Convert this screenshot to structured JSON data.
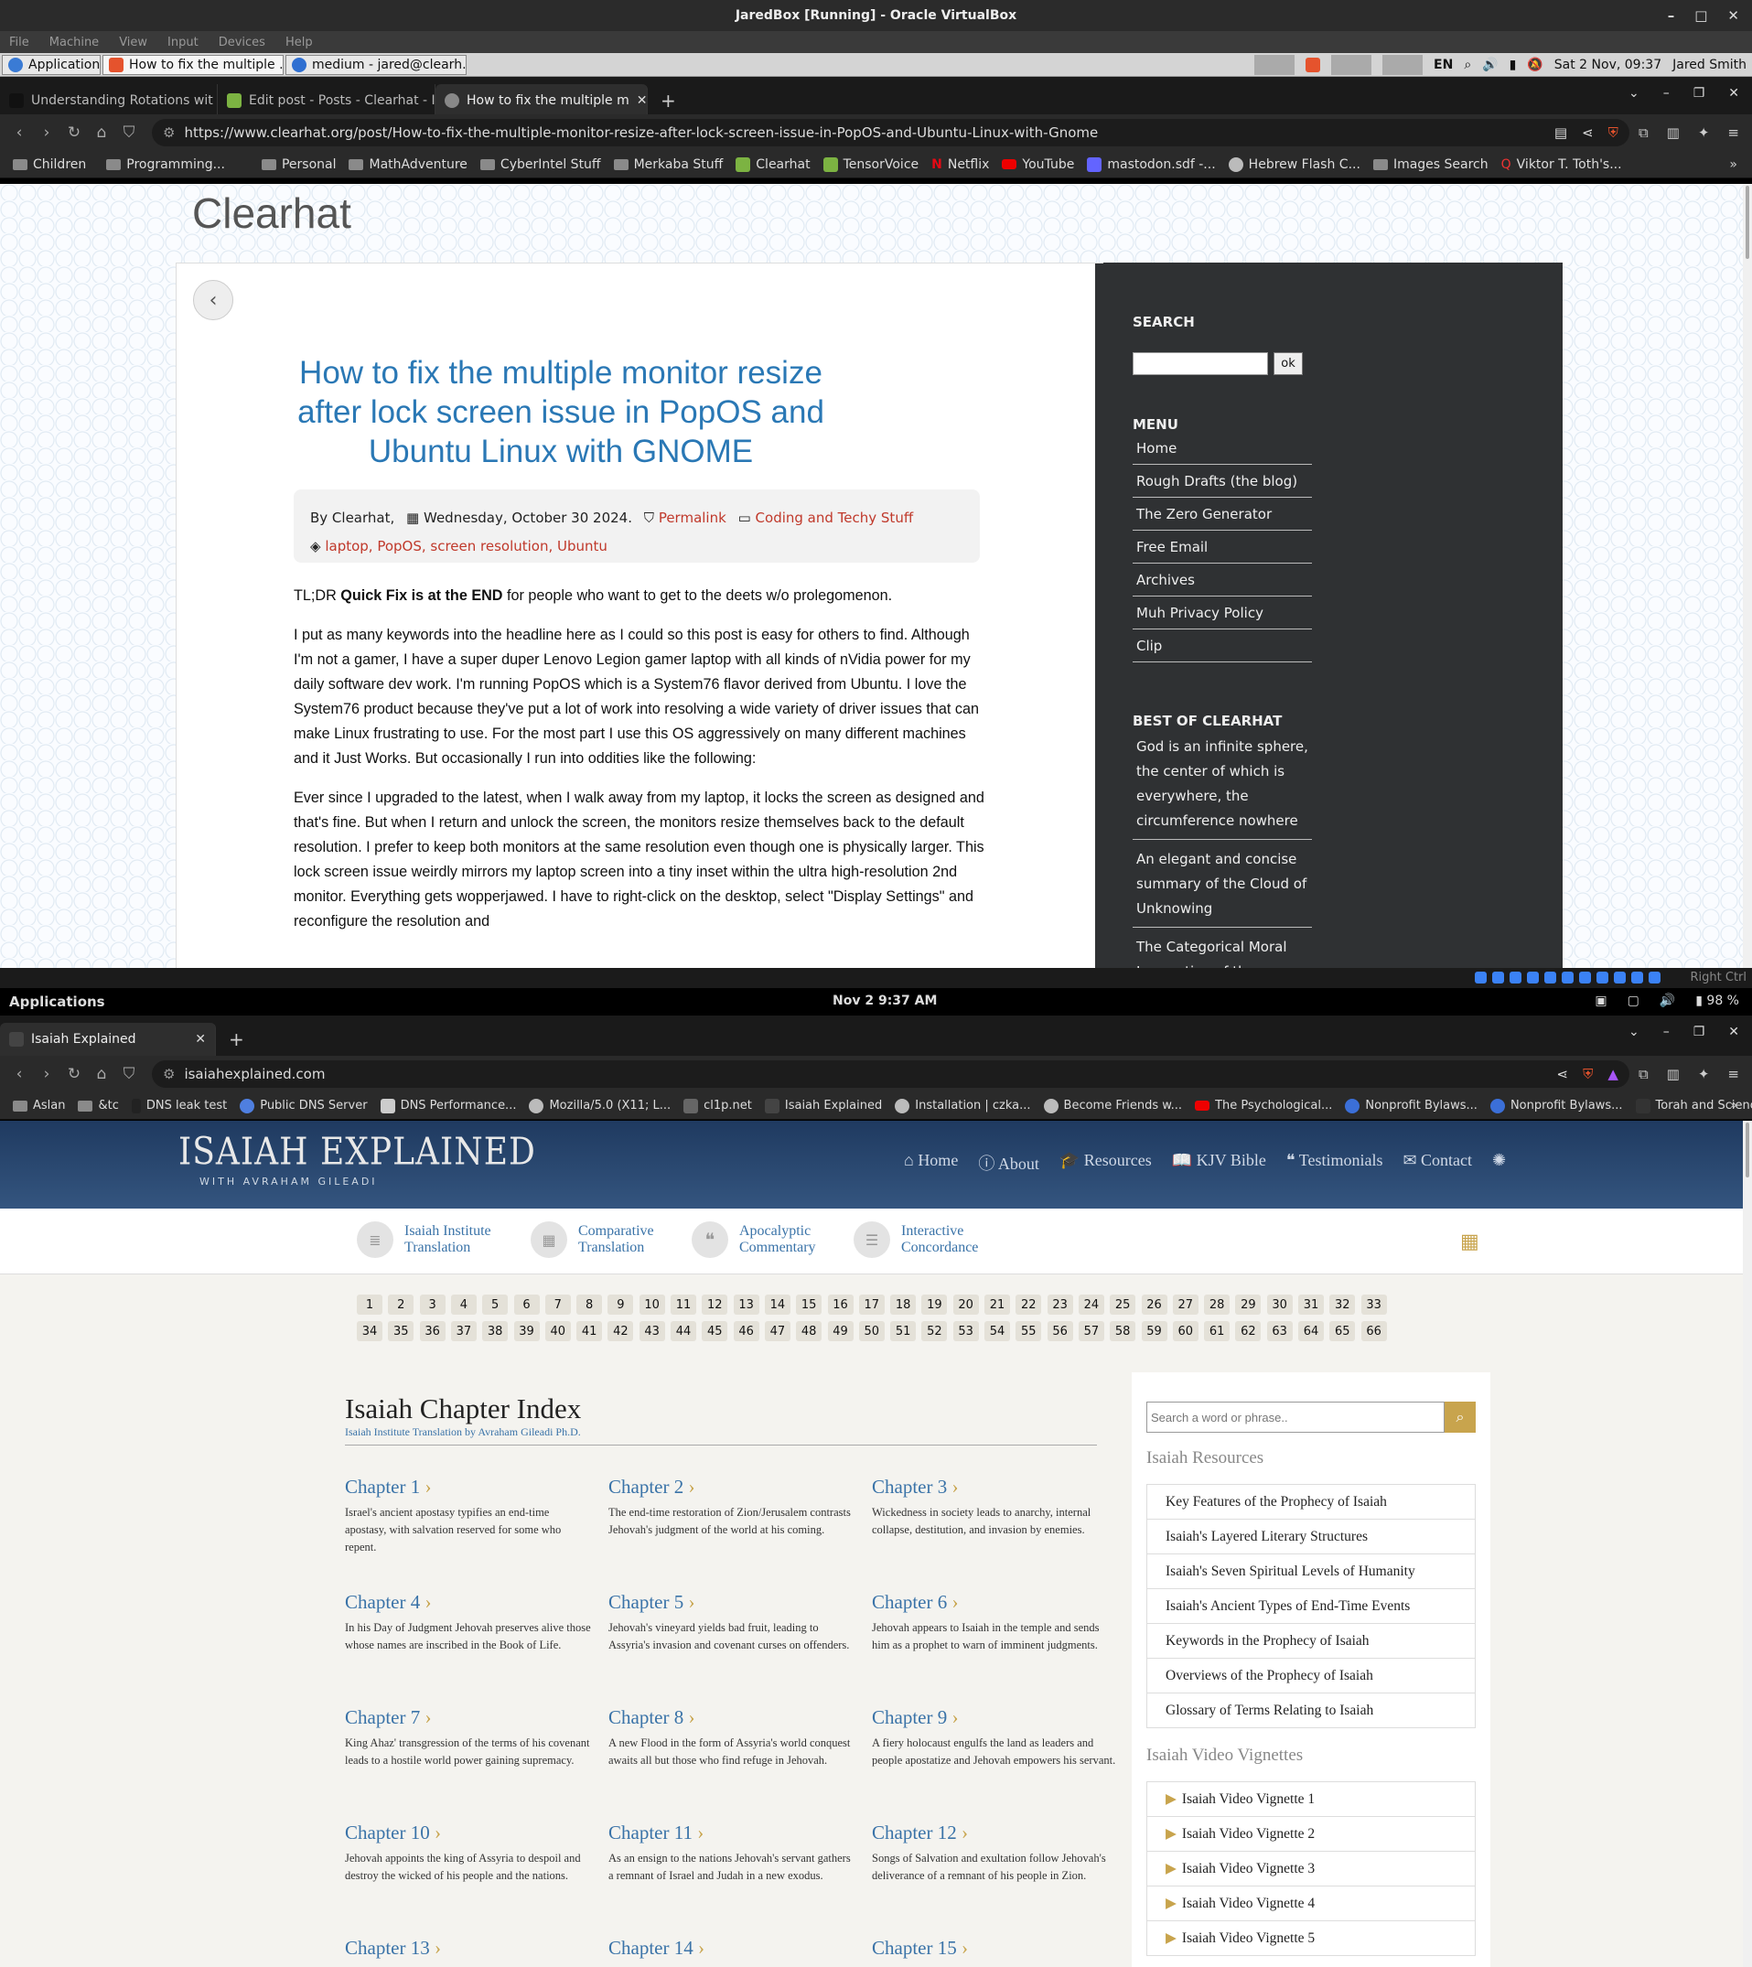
{
  "host": {
    "title": "JaredBox [Running] - Oracle VirtualBox",
    "menu": [
      "File",
      "Machine",
      "View",
      "Input",
      "Devices",
      "Help"
    ],
    "controls": [
      "–",
      "□",
      "✕"
    ]
  },
  "guest_panel": {
    "apps": "Applications",
    "tasks": [
      "How to fix the multiple ...",
      "medium - jared@clearh..."
    ],
    "lang": "EN",
    "datetime": "Sat  2 Nov, 09:37",
    "user": "Jared Smith"
  },
  "browser1": {
    "tabs": [
      "Understanding Rotations wit",
      "Edit post - Posts - Clearhat - I",
      "How to fix the multiple m"
    ],
    "url": "https://www.clearhat.org/post/How-to-fix-the-multiple-monitor-resize-after-lock-screen-issue-in-PopOS-and-Ubuntu-Linux-with-Gnome",
    "bookmarks": [
      "Children",
      "Programming...",
      "Personal",
      "MathAdventure",
      "CyberIntel Stuff",
      "Merkaba Stuff",
      "Clearhat",
      "TensorVoice",
      "Netflix",
      "YouTube",
      "mastodon.sdf -...",
      "Hebrew Flash C...",
      "Images Search",
      "Viktor T. Toth's..."
    ]
  },
  "clearhat": {
    "logo": "Clearhat",
    "title": "How to fix the multiple monitor resize after lock screen issue in PopOS and Ubuntu Linux with GNOME",
    "meta": {
      "by": "By Clearhat,",
      "date": "Wednesday, October 30 2024.",
      "permalink": "Permalink",
      "category": "Coding and Techy Stuff",
      "tags": "laptop, PopOS, screen resolution, Ubuntu"
    },
    "p1a": "TL;DR ",
    "p1b": "Quick Fix is at the END",
    "p1c": " for people who want to get to the deets w/o prolegomenon.",
    "p2": "I put as many keywords into the headline here as I could so this post is easy for others to find. Although I'm not a gamer, I have a super duper Lenovo Legion gamer laptop with all kinds of nVidia power for my daily software dev work. I'm running PopOS which is a System76 flavor derived from Ubuntu. I love the System76 product because they've put a lot of work into resolving a wide variety of driver issues that can make Linux frustrating to use. For the most part I use this OS aggressively on many different machines and it Just Works. But occasionally I run into oddities like the following:",
    "p3": "Ever since I upgraded to the latest, when I walk away from my laptop, it locks the screen as designed and that's fine. But when I return and unlock the screen, the monitors resize themselves back to the default resolution. I prefer to keep both monitors at the same resolution even though one is physically larger. This lock screen issue weirdly mirrors my laptop screen into a tiny inset within the ultra high-resolution 2nd monitor. Everything gets wopperjawed. I have to right-click on the desktop, select \"Display Settings\" and reconfigure the resolution and",
    "sidebar": {
      "search_h": "SEARCH",
      "ok": "ok",
      "menu_h": "MENU",
      "menu": [
        "Home",
        "Rough Drafts (the blog)",
        "The Zero Generator",
        "Free Email",
        "Archives",
        "Muh Privacy Policy",
        "Clip"
      ],
      "best_h": "BEST OF CLEARHAT",
      "best": [
        "God is an infinite sphere, the center of which is everywhere, the circumference nowhere",
        "An elegant and concise summary of the Cloud of Unknowing",
        "The Categorical Moral Imperative of the Dunning"
      ]
    }
  },
  "tray_strip": "Right Ctrl",
  "gnome": {
    "apps": "Applications",
    "clock": "Nov 2  9:37 AM",
    "battery": "98 %"
  },
  "browser2": {
    "tab": "Isaiah Explained",
    "url": "isaiahexplained.com",
    "bookmarks": [
      "Aslan",
      "&tc",
      "DNS leak test",
      "Public DNS Server",
      "DNS Performance...",
      "Mozilla/5.0 (X11; L...",
      "cl1p.net",
      "Isaiah Explained",
      "Installation | czka...",
      "Become Friends w...",
      "The Psychological...",
      "Nonprofit Bylaws...",
      "Nonprofit Bylaws...",
      "Torah and Scienc..."
    ]
  },
  "isaiah": {
    "logo": "ISAIAH EXPLAINED",
    "logo_sub": "WITH AVRAHAM GILEADI",
    "nav": [
      "Home",
      "About",
      "Resources",
      "KJV Bible",
      "Testimonials",
      "Contact"
    ],
    "tools": [
      [
        "Isaiah Institute",
        "Translation"
      ],
      [
        "Comparative",
        "Translation"
      ],
      [
        "Apocalyptic",
        "Commentary"
      ],
      [
        "Interactive",
        "Concordance"
      ]
    ],
    "numbers_row1": [
      "1",
      "2",
      "3",
      "4",
      "5",
      "6",
      "7",
      "8",
      "9",
      "10",
      "11",
      "12",
      "13",
      "14",
      "15",
      "16",
      "17",
      "18",
      "19",
      "20",
      "21",
      "22",
      "23",
      "24",
      "25",
      "26",
      "27",
      "28",
      "29",
      "30",
      "31",
      "32",
      "33"
    ],
    "numbers_row2": [
      "34",
      "35",
      "36",
      "37",
      "38",
      "39",
      "40",
      "41",
      "42",
      "43",
      "44",
      "45",
      "46",
      "47",
      "48",
      "49",
      "50",
      "51",
      "52",
      "53",
      "54",
      "55",
      "56",
      "57",
      "58",
      "59",
      "60",
      "61",
      "62",
      "63",
      "64",
      "65",
      "66"
    ],
    "index_title": "Isaiah Chapter Index",
    "index_sub": "Isaiah Institute Translation by Avraham Gileadi Ph.D.",
    "chapters": [
      {
        "t": "Chapter 1",
        "d": "Israel's ancient apostasy typifies an end-time apostasy, with salvation reserved for some who repent."
      },
      {
        "t": "Chapter 2",
        "d": "The end-time restoration of Zion/Jerusalem contrasts Jehovah's judgment of the world at his coming."
      },
      {
        "t": "Chapter 3",
        "d": "Wickedness in society leads to anarchy, internal collapse, destitution, and invasion by enemies."
      },
      {
        "t": "Chapter 4",
        "d": "In his Day of Judgment Jehovah preserves alive those whose names are inscribed in the Book of Life."
      },
      {
        "t": "Chapter 5",
        "d": "Jehovah's vineyard yields bad fruit, leading to Assyria's invasion and covenant curses on offenders."
      },
      {
        "t": "Chapter 6",
        "d": "Jehovah appears to Isaiah in the temple and sends him as a prophet to warn of imminent judgments."
      },
      {
        "t": "Chapter 7",
        "d": "King Ahaz' transgression of the terms of his covenant leads to a hostile world power gaining supremacy."
      },
      {
        "t": "Chapter 8",
        "d": "A new Flood in the form of Assyria's world conquest awaits all but those who find refuge in Jehovah."
      },
      {
        "t": "Chapter 9",
        "d": "A fiery holocaust engulfs the land as leaders and people apostatize and Jehovah empowers his servant."
      },
      {
        "t": "Chapter 10",
        "d": "Jehovah appoints the king of Assyria to despoil and destroy the wicked of his people and the nations."
      },
      {
        "t": "Chapter 11",
        "d": "As an ensign to the nations Jehovah's servant gathers a remnant of Israel and Judah in a new exodus."
      },
      {
        "t": "Chapter 12",
        "d": "Songs of Salvation and exultation follow Jehovah's deliverance of a remnant of his people in Zion."
      },
      {
        "t": "Chapter 13",
        "d": ""
      },
      {
        "t": "Chapter 14",
        "d": ""
      },
      {
        "t": "Chapter 15",
        "d": ""
      }
    ],
    "search_ph": "Search a word or phrase..",
    "res_h": "Isaiah Resources",
    "resources": [
      "Key Features of the Prophecy of Isaiah",
      "Isaiah's Layered Literary Structures",
      "Isaiah's Seven Spiritual Levels of Humanity",
      "Isaiah's Ancient Types of End-Time Events",
      "Keywords in the Prophecy of Isaiah",
      "Overviews of the Prophecy of Isaiah",
      "Glossary of Terms Relating to Isaiah"
    ],
    "vid_h": "Isaiah Video Vignettes",
    "videos": [
      "Isaiah Video Vignette 1",
      "Isaiah Video Vignette 2",
      "Isaiah Video Vignette 3",
      "Isaiah Video Vignette 4",
      "Isaiah Video Vignette 5"
    ]
  },
  "colors": {
    "link_blue": "#2a78b5",
    "link_red": "#c0392b",
    "sidebar_dark": "#2f3133",
    "isaiah_header": "#2c4a72",
    "gold": "#c8a44d"
  }
}
